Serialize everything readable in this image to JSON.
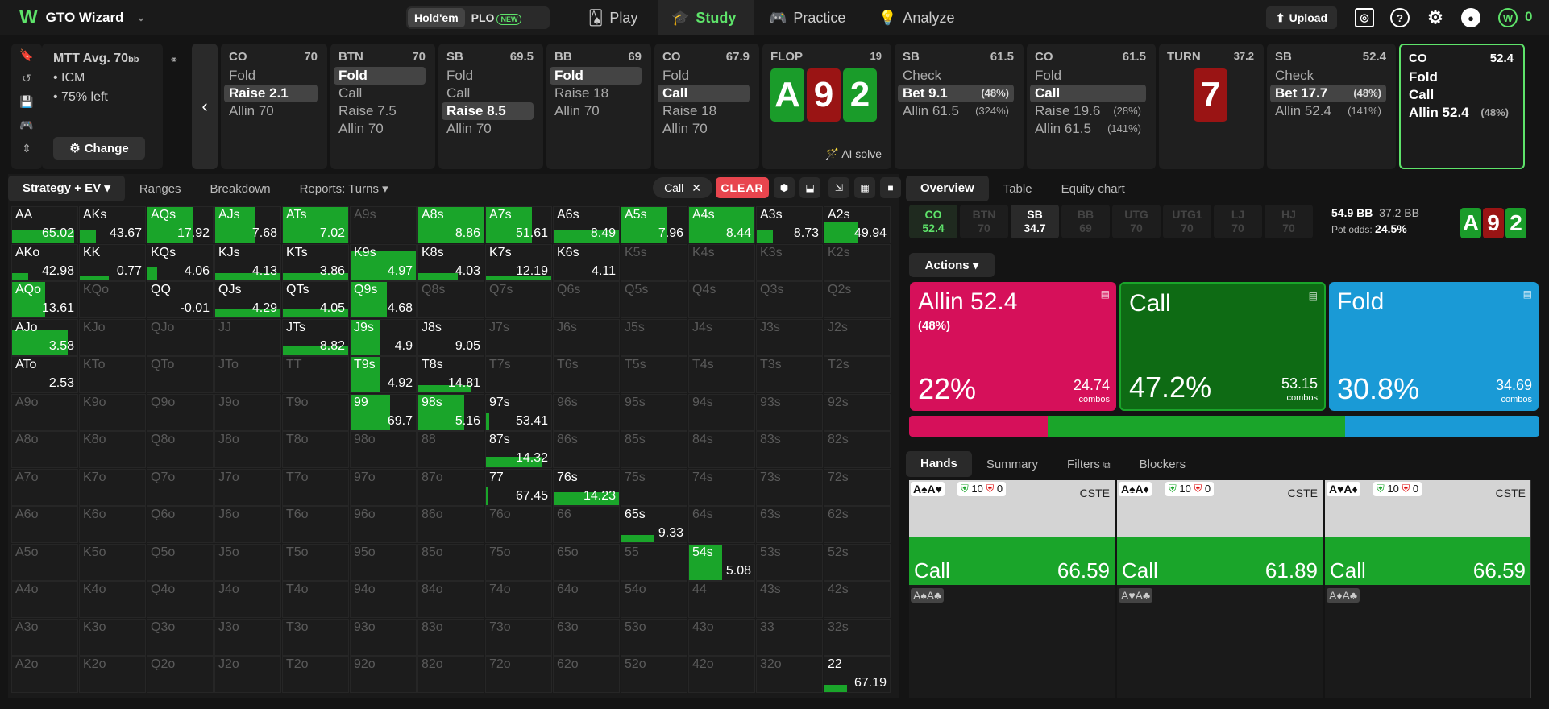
{
  "app": {
    "name": "GTO Wizard",
    "logo": "W"
  },
  "gametype": {
    "holdem": "Hold'em",
    "plo": "PLO",
    "new_badge": "NEW"
  },
  "nav": [
    {
      "label": "Play",
      "icon": "cards-icon"
    },
    {
      "label": "Study",
      "icon": "graduation-cap-icon",
      "active": true
    },
    {
      "label": "Practice",
      "icon": "gamepad-icon"
    },
    {
      "label": "Analyze",
      "icon": "lightbulb-icon"
    }
  ],
  "toolbar": {
    "upload": "Upload",
    "points": "0"
  },
  "spot": {
    "format": "MTT",
    "depth": "Avg. 70",
    "depth_unit": "bb",
    "options": [
      "ICM",
      "75% left"
    ],
    "change": "Change"
  },
  "colors": {
    "green": "#1aa52a",
    "allin": "#d6105a",
    "call": "#0e6b14",
    "fold": "#1a9ad6",
    "accent": "#5ee36a"
  },
  "history": [
    {
      "pos": "CO",
      "stack": "70",
      "actions": [
        {
          "l": "Fold"
        },
        {
          "l": "Raise 2.1",
          "sel": true
        },
        {
          "l": "Allin 70"
        }
      ]
    },
    {
      "pos": "BTN",
      "stack": "70",
      "actions": [
        {
          "l": "Fold",
          "sel": true
        },
        {
          "l": "Call"
        },
        {
          "l": "Raise 7.5"
        },
        {
          "l": "Allin 70"
        }
      ]
    },
    {
      "pos": "SB",
      "stack": "69.5",
      "actions": [
        {
          "l": "Fold"
        },
        {
          "l": "Call"
        },
        {
          "l": "Raise 8.5",
          "sel": true
        },
        {
          "l": "Allin 70"
        }
      ]
    },
    {
      "pos": "BB",
      "stack": "69",
      "actions": [
        {
          "l": "Fold",
          "sel": true
        },
        {
          "l": "Raise 18"
        },
        {
          "l": "Allin 70"
        }
      ]
    },
    {
      "pos": "CO",
      "stack": "67.9",
      "actions": [
        {
          "l": "Fold"
        },
        {
          "l": "Call",
          "sel": true
        },
        {
          "l": "Raise 18"
        },
        {
          "l": "Allin 70"
        }
      ]
    },
    {
      "pos": "FLOP",
      "stack": "19",
      "board": [
        "A",
        "9",
        "2"
      ],
      "ai": "AI solve"
    },
    {
      "pos": "SB",
      "stack": "61.5",
      "actions": [
        {
          "l": "Check"
        },
        {
          "l": "Bet 9.1",
          "p": "(48%)",
          "sel": true
        },
        {
          "l": "Allin 61.5",
          "p": "(324%)"
        }
      ]
    },
    {
      "pos": "CO",
      "stack": "61.5",
      "actions": [
        {
          "l": "Fold"
        },
        {
          "l": "Call",
          "sel": true
        },
        {
          "l": "Raise 19.6",
          "p": "(28%)"
        },
        {
          "l": "Allin 61.5",
          "p": "(141%)"
        }
      ]
    },
    {
      "pos": "TURN",
      "stack": "37.2",
      "board": [
        "7"
      ]
    },
    {
      "pos": "SB",
      "stack": "52.4",
      "actions": [
        {
          "l": "Check"
        },
        {
          "l": "Bet 17.7",
          "p": "(48%)",
          "sel": true
        },
        {
          "l": "Allin 52.4",
          "p": "(141%)"
        }
      ]
    },
    {
      "pos": "CO",
      "stack": "52.4",
      "actions": [
        {
          "l": "Fold"
        },
        {
          "l": "Call"
        },
        {
          "l": "Allin 52.4",
          "p": "(48%)"
        }
      ],
      "current": true
    }
  ],
  "left_tabs": [
    "Strategy + EV",
    "Ranges",
    "Breakdown",
    "Reports: Turns"
  ],
  "filter_chip": "Call",
  "clear": "CLEAR",
  "matrix": [
    [
      [
        "AA",
        "65.02",
        0.95,
        0.35
      ],
      [
        "AKs",
        "43.67",
        0.25,
        0.35
      ],
      [
        "AQs",
        "17.92",
        0.7,
        1
      ],
      [
        "AJs",
        "7.68",
        0.6,
        1
      ],
      [
        "ATs",
        "7.02",
        1,
        1
      ],
      [
        "A9s",
        "",
        0,
        0
      ],
      [
        "A8s",
        "8.86",
        1,
        1
      ],
      [
        "A7s",
        "51.61",
        0.7,
        1
      ],
      [
        "A6s",
        "8.49",
        1,
        0.35
      ],
      [
        "A5s",
        "7.96",
        0.7,
        1
      ],
      [
        "A4s",
        "8.44",
        1,
        1
      ],
      [
        "A3s",
        "8.73",
        0.25,
        0.35
      ],
      [
        "A2s",
        "49.94",
        0.5,
        0.6
      ]
    ],
    [
      [
        "AKo",
        "42.98",
        0.25,
        0.2
      ],
      [
        "KK",
        "0.77",
        0.45,
        0.1
      ],
      [
        "KQs",
        "4.06",
        0.15,
        0.35
      ],
      [
        "KJs",
        "4.13",
        1,
        0.2
      ],
      [
        "KTs",
        "3.86",
        1,
        0.2
      ],
      [
        "K9s",
        "4.97",
        1,
        0.8
      ],
      [
        "K8s",
        "4.03",
        0.6,
        0.2
      ],
      [
        "K7s",
        "12.19",
        1,
        0.1
      ],
      [
        "K6s",
        "4.11",
        0,
        0
      ],
      [
        "K5s",
        "",
        0,
        0
      ],
      [
        "K4s",
        "",
        0,
        0
      ],
      [
        "K3s",
        "",
        0,
        0
      ],
      [
        "K2s",
        "",
        0,
        0
      ]
    ],
    [
      [
        "AQo",
        "13.61",
        0.5,
        1
      ],
      [
        "KQo",
        "",
        0,
        0
      ],
      [
        "QQ",
        "-0.01",
        0,
        0
      ],
      [
        "QJs",
        "4.29",
        1,
        0.25
      ],
      [
        "QTs",
        "4.05",
        1,
        0.25
      ],
      [
        "Q9s",
        "4.68",
        0.55,
        1
      ],
      [
        "Q8s",
        "",
        0,
        0
      ],
      [
        "Q7s",
        "",
        0,
        0
      ],
      [
        "Q6s",
        "",
        0,
        0
      ],
      [
        "Q5s",
        "",
        0,
        0
      ],
      [
        "Q4s",
        "",
        0,
        0
      ],
      [
        "Q3s",
        "",
        0,
        0
      ],
      [
        "Q2s",
        "",
        0,
        0
      ]
    ],
    [
      [
        "AJo",
        "3.58",
        0.85,
        0.7
      ],
      [
        "KJo",
        "",
        0,
        0
      ],
      [
        "QJo",
        "",
        0,
        0
      ],
      [
        "JJ",
        "",
        0,
        0
      ],
      [
        "JTs",
        "8.82",
        1,
        0.25
      ],
      [
        "J9s",
        "4.9",
        0.45,
        1
      ],
      [
        "J8s",
        "9.05",
        0,
        0
      ],
      [
        "J7s",
        "",
        0,
        0
      ],
      [
        "J6s",
        "",
        0,
        0
      ],
      [
        "J5s",
        "",
        0,
        0
      ],
      [
        "J4s",
        "",
        0,
        0
      ],
      [
        "J3s",
        "",
        0,
        0
      ],
      [
        "J2s",
        "",
        0,
        0
      ]
    ],
    [
      [
        "ATo",
        "2.53",
        0,
        0
      ],
      [
        "KTo",
        "",
        0,
        0
      ],
      [
        "QTo",
        "",
        0,
        0
      ],
      [
        "JTo",
        "",
        0,
        0
      ],
      [
        "TT",
        "",
        0,
        0
      ],
      [
        "T9s",
        "4.92",
        0.45,
        1
      ],
      [
        "T8s",
        "14.81",
        0.8,
        0.2
      ],
      [
        "T7s",
        "",
        0,
        0
      ],
      [
        "T6s",
        "",
        0,
        0
      ],
      [
        "T5s",
        "",
        0,
        0
      ],
      [
        "T4s",
        "",
        0,
        0
      ],
      [
        "T3s",
        "",
        0,
        0
      ],
      [
        "T2s",
        "",
        0,
        0
      ]
    ],
    [
      [
        "A9o",
        "",
        0,
        0
      ],
      [
        "K9o",
        "",
        0,
        0
      ],
      [
        "Q9o",
        "",
        0,
        0
      ],
      [
        "J9o",
        "",
        0,
        0
      ],
      [
        "T9o",
        "",
        0,
        0
      ],
      [
        "99",
        "69.7",
        0.6,
        1
      ],
      [
        "98s",
        "5.16",
        0.7,
        1
      ],
      [
        "97s",
        "53.41",
        0.05,
        0.5
      ],
      [
        "96s",
        "",
        0,
        0
      ],
      [
        "95s",
        "",
        0,
        0
      ],
      [
        "94s",
        "",
        0,
        0
      ],
      [
        "93s",
        "",
        0,
        0
      ],
      [
        "92s",
        "",
        0,
        0
      ]
    ],
    [
      [
        "A8o",
        "",
        0,
        0
      ],
      [
        "K8o",
        "",
        0,
        0
      ],
      [
        "Q8o",
        "",
        0,
        0
      ],
      [
        "J8o",
        "",
        0,
        0
      ],
      [
        "T8o",
        "",
        0,
        0
      ],
      [
        "98o",
        "",
        0,
        0
      ],
      [
        "88",
        "",
        0,
        0
      ],
      [
        "87s",
        "14.32",
        0.85,
        0.3
      ],
      [
        "86s",
        "",
        0,
        0
      ],
      [
        "85s",
        "",
        0,
        0
      ],
      [
        "84s",
        "",
        0,
        0
      ],
      [
        "83s",
        "",
        0,
        0
      ],
      [
        "82s",
        "",
        0,
        0
      ]
    ],
    [
      [
        "A7o",
        "",
        0,
        0
      ],
      [
        "K7o",
        "",
        0,
        0
      ],
      [
        "Q7o",
        "",
        0,
        0
      ],
      [
        "J7o",
        "",
        0,
        0
      ],
      [
        "T7o",
        "",
        0,
        0
      ],
      [
        "97o",
        "",
        0,
        0
      ],
      [
        "87o",
        "",
        0,
        0
      ],
      [
        "77",
        "67.45",
        0.04,
        0.5
      ],
      [
        "76s",
        "14.23",
        1,
        0.35
      ],
      [
        "75s",
        "",
        0,
        0
      ],
      [
        "74s",
        "",
        0,
        0
      ],
      [
        "73s",
        "",
        0,
        0
      ],
      [
        "72s",
        "",
        0,
        0
      ]
    ],
    [
      [
        "A6o",
        "",
        0,
        0
      ],
      [
        "K6o",
        "",
        0,
        0
      ],
      [
        "Q6o",
        "",
        0,
        0
      ],
      [
        "J6o",
        "",
        0,
        0
      ],
      [
        "T6o",
        "",
        0,
        0
      ],
      [
        "96o",
        "",
        0,
        0
      ],
      [
        "86o",
        "",
        0,
        0
      ],
      [
        "76o",
        "",
        0,
        0
      ],
      [
        "66",
        "",
        0,
        0
      ],
      [
        "65s",
        "9.33",
        0.5,
        0.2
      ],
      [
        "64s",
        "",
        0,
        0
      ],
      [
        "63s",
        "",
        0,
        0
      ],
      [
        "62s",
        "",
        0,
        0
      ]
    ],
    [
      [
        "A5o",
        "",
        0,
        0
      ],
      [
        "K5o",
        "",
        0,
        0
      ],
      [
        "Q5o",
        "",
        0,
        0
      ],
      [
        "J5o",
        "",
        0,
        0
      ],
      [
        "T5o",
        "",
        0,
        0
      ],
      [
        "95o",
        "",
        0,
        0
      ],
      [
        "85o",
        "",
        0,
        0
      ],
      [
        "75o",
        "",
        0,
        0
      ],
      [
        "65o",
        "",
        0,
        0
      ],
      [
        "55",
        "",
        0,
        0
      ],
      [
        "54s",
        "5.08",
        0.5,
        1
      ],
      [
        "53s",
        "",
        0,
        0
      ],
      [
        "52s",
        "",
        0,
        0
      ]
    ],
    [
      [
        "A4o",
        "",
        0,
        0
      ],
      [
        "K4o",
        "",
        0,
        0
      ],
      [
        "Q4o",
        "",
        0,
        0
      ],
      [
        "J4o",
        "",
        0,
        0
      ],
      [
        "T4o",
        "",
        0,
        0
      ],
      [
        "94o",
        "",
        0,
        0
      ],
      [
        "84o",
        "",
        0,
        0
      ],
      [
        "74o",
        "",
        0,
        0
      ],
      [
        "64o",
        "",
        0,
        0
      ],
      [
        "54o",
        "",
        0,
        0
      ],
      [
        "44",
        "",
        0,
        0
      ],
      [
        "43s",
        "",
        0,
        0
      ],
      [
        "42s",
        "",
        0,
        0
      ]
    ],
    [
      [
        "A3o",
        "",
        0,
        0
      ],
      [
        "K3o",
        "",
        0,
        0
      ],
      [
        "Q3o",
        "",
        0,
        0
      ],
      [
        "J3o",
        "",
        0,
        0
      ],
      [
        "T3o",
        "",
        0,
        0
      ],
      [
        "93o",
        "",
        0,
        0
      ],
      [
        "83o",
        "",
        0,
        0
      ],
      [
        "73o",
        "",
        0,
        0
      ],
      [
        "63o",
        "",
        0,
        0
      ],
      [
        "53o",
        "",
        0,
        0
      ],
      [
        "43o",
        "",
        0,
        0
      ],
      [
        "33",
        "",
        0,
        0
      ],
      [
        "32s",
        "",
        0,
        0
      ]
    ],
    [
      [
        "A2o",
        "",
        0,
        0
      ],
      [
        "K2o",
        "",
        0,
        0
      ],
      [
        "Q2o",
        "",
        0,
        0
      ],
      [
        "J2o",
        "",
        0,
        0
      ],
      [
        "T2o",
        "",
        0,
        0
      ],
      [
        "92o",
        "",
        0,
        0
      ],
      [
        "82o",
        "",
        0,
        0
      ],
      [
        "72o",
        "",
        0,
        0
      ],
      [
        "62o",
        "",
        0,
        0
      ],
      [
        "52o",
        "",
        0,
        0
      ],
      [
        "42o",
        "",
        0,
        0
      ],
      [
        "32o",
        "",
        0,
        0
      ],
      [
        "22",
        "67.19",
        0.35,
        0.2
      ]
    ]
  ],
  "right_tabs": [
    "Overview",
    "Table",
    "Equity chart"
  ],
  "positions": [
    {
      "p": "CO",
      "s": "52.4",
      "on": true,
      "co": true
    },
    {
      "p": "BTN",
      "s": "70"
    },
    {
      "p": "SB",
      "s": "34.7",
      "on": true
    },
    {
      "p": "BB",
      "s": "69"
    },
    {
      "p": "UTG",
      "s": "70"
    },
    {
      "p": "UTG1",
      "s": "70"
    },
    {
      "p": "LJ",
      "s": "70"
    },
    {
      "p": "HJ",
      "s": "70"
    }
  ],
  "pot": {
    "main": "54.9 BB",
    "eff": "37.2 BB",
    "odds_label": "Pot odds:",
    "odds": "24.5%"
  },
  "board_mini": [
    "A",
    "9",
    "2"
  ],
  "actions_label": "Actions",
  "actions": [
    {
      "name": "Allin 52.4",
      "sub": "(48%)",
      "pct": "22%",
      "combos": "24.74",
      "combos_label": "combos",
      "share": 22
    },
    {
      "name": "Call",
      "sub": "",
      "pct": "47.2%",
      "combos": "53.15",
      "combos_label": "combos",
      "share": 47.2
    },
    {
      "name": "Fold",
      "sub": "",
      "pct": "30.8%",
      "combos": "34.69",
      "combos_label": "combos",
      "share": 30.8
    }
  ],
  "bottom_tabs": [
    "Hands",
    "Summary",
    "Filters",
    "Blockers"
  ],
  "hands": [
    {
      "cards": "A♠A♥",
      "s1": "10",
      "s2": "0",
      "tag": "CSTE",
      "action": "Call",
      "ev": "66.59",
      "blk": "A♠A♣"
    },
    {
      "cards": "A♠A♦",
      "s1": "10",
      "s2": "0",
      "tag": "CSTE",
      "action": "Call",
      "ev": "61.89",
      "blk": "A♥A♣"
    },
    {
      "cards": "A♥A♦",
      "s1": "10",
      "s2": "0",
      "tag": "CSTE",
      "action": "Call",
      "ev": "66.59",
      "blk": "A♦A♣"
    }
  ]
}
